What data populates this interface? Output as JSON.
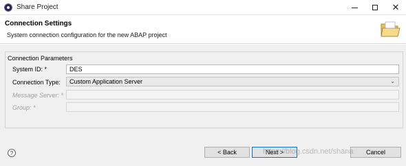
{
  "window": {
    "title": "Share Project",
    "icon": "eclipse-icon"
  },
  "header": {
    "title": "Connection Settings",
    "description": "System connection configuration for the new ABAP project",
    "icon": "folder-icon"
  },
  "group": {
    "label": "Connection Parameters",
    "fields": {
      "system_id": {
        "label": "System ID: *",
        "value": "DES"
      },
      "connection_type": {
        "label": "Connection Type:",
        "value": "Custom Application Server"
      },
      "message_server": {
        "label": "Message Server: *",
        "value": ""
      },
      "group": {
        "label": "Group: *",
        "value": ""
      }
    }
  },
  "footer": {
    "help_label": "?",
    "back_label": "< Back",
    "next_label": "Next >",
    "cancel_label": "Cancel",
    "watermark": "https://blog.csdn.net/shana"
  },
  "colors": {
    "dialog_bg": "#f0f0f0",
    "focus_border": "#0078d7"
  }
}
